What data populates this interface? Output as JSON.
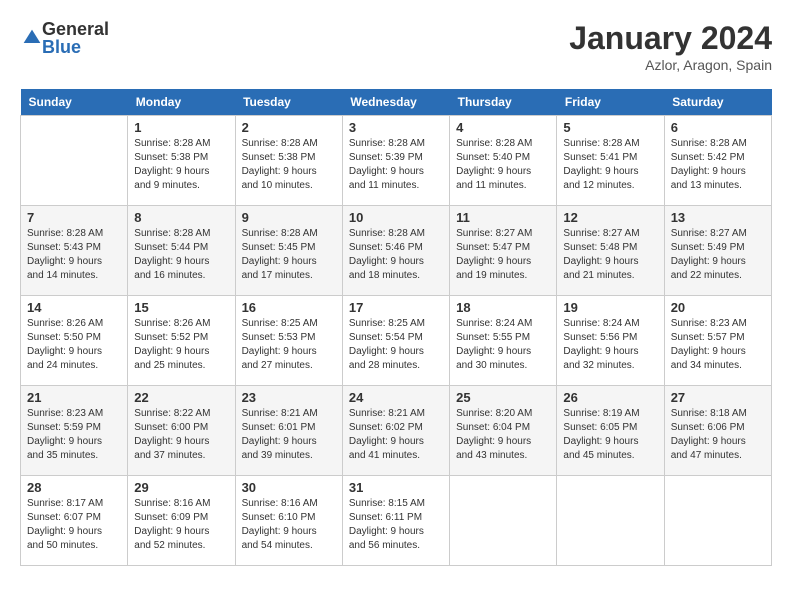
{
  "header": {
    "logo_general": "General",
    "logo_blue": "Blue",
    "month_title": "January 2024",
    "location": "Azlor, Aragon, Spain"
  },
  "columns": [
    "Sunday",
    "Monday",
    "Tuesday",
    "Wednesday",
    "Thursday",
    "Friday",
    "Saturday"
  ],
  "weeks": [
    [
      {
        "day": "",
        "info": ""
      },
      {
        "day": "1",
        "info": "Sunrise: 8:28 AM\nSunset: 5:38 PM\nDaylight: 9 hours\nand 9 minutes."
      },
      {
        "day": "2",
        "info": "Sunrise: 8:28 AM\nSunset: 5:38 PM\nDaylight: 9 hours\nand 10 minutes."
      },
      {
        "day": "3",
        "info": "Sunrise: 8:28 AM\nSunset: 5:39 PM\nDaylight: 9 hours\nand 11 minutes."
      },
      {
        "day": "4",
        "info": "Sunrise: 8:28 AM\nSunset: 5:40 PM\nDaylight: 9 hours\nand 11 minutes."
      },
      {
        "day": "5",
        "info": "Sunrise: 8:28 AM\nSunset: 5:41 PM\nDaylight: 9 hours\nand 12 minutes."
      },
      {
        "day": "6",
        "info": "Sunrise: 8:28 AM\nSunset: 5:42 PM\nDaylight: 9 hours\nand 13 minutes."
      }
    ],
    [
      {
        "day": "7",
        "info": "Sunrise: 8:28 AM\nSunset: 5:43 PM\nDaylight: 9 hours\nand 14 minutes."
      },
      {
        "day": "8",
        "info": "Sunrise: 8:28 AM\nSunset: 5:44 PM\nDaylight: 9 hours\nand 16 minutes."
      },
      {
        "day": "9",
        "info": "Sunrise: 8:28 AM\nSunset: 5:45 PM\nDaylight: 9 hours\nand 17 minutes."
      },
      {
        "day": "10",
        "info": "Sunrise: 8:28 AM\nSunset: 5:46 PM\nDaylight: 9 hours\nand 18 minutes."
      },
      {
        "day": "11",
        "info": "Sunrise: 8:27 AM\nSunset: 5:47 PM\nDaylight: 9 hours\nand 19 minutes."
      },
      {
        "day": "12",
        "info": "Sunrise: 8:27 AM\nSunset: 5:48 PM\nDaylight: 9 hours\nand 21 minutes."
      },
      {
        "day": "13",
        "info": "Sunrise: 8:27 AM\nSunset: 5:49 PM\nDaylight: 9 hours\nand 22 minutes."
      }
    ],
    [
      {
        "day": "14",
        "info": "Sunrise: 8:26 AM\nSunset: 5:50 PM\nDaylight: 9 hours\nand 24 minutes."
      },
      {
        "day": "15",
        "info": "Sunrise: 8:26 AM\nSunset: 5:52 PM\nDaylight: 9 hours\nand 25 minutes."
      },
      {
        "day": "16",
        "info": "Sunrise: 8:25 AM\nSunset: 5:53 PM\nDaylight: 9 hours\nand 27 minutes."
      },
      {
        "day": "17",
        "info": "Sunrise: 8:25 AM\nSunset: 5:54 PM\nDaylight: 9 hours\nand 28 minutes."
      },
      {
        "day": "18",
        "info": "Sunrise: 8:24 AM\nSunset: 5:55 PM\nDaylight: 9 hours\nand 30 minutes."
      },
      {
        "day": "19",
        "info": "Sunrise: 8:24 AM\nSunset: 5:56 PM\nDaylight: 9 hours\nand 32 minutes."
      },
      {
        "day": "20",
        "info": "Sunrise: 8:23 AM\nSunset: 5:57 PM\nDaylight: 9 hours\nand 34 minutes."
      }
    ],
    [
      {
        "day": "21",
        "info": "Sunrise: 8:23 AM\nSunset: 5:59 PM\nDaylight: 9 hours\nand 35 minutes."
      },
      {
        "day": "22",
        "info": "Sunrise: 8:22 AM\nSunset: 6:00 PM\nDaylight: 9 hours\nand 37 minutes."
      },
      {
        "day": "23",
        "info": "Sunrise: 8:21 AM\nSunset: 6:01 PM\nDaylight: 9 hours\nand 39 minutes."
      },
      {
        "day": "24",
        "info": "Sunrise: 8:21 AM\nSunset: 6:02 PM\nDaylight: 9 hours\nand 41 minutes."
      },
      {
        "day": "25",
        "info": "Sunrise: 8:20 AM\nSunset: 6:04 PM\nDaylight: 9 hours\nand 43 minutes."
      },
      {
        "day": "26",
        "info": "Sunrise: 8:19 AM\nSunset: 6:05 PM\nDaylight: 9 hours\nand 45 minutes."
      },
      {
        "day": "27",
        "info": "Sunrise: 8:18 AM\nSunset: 6:06 PM\nDaylight: 9 hours\nand 47 minutes."
      }
    ],
    [
      {
        "day": "28",
        "info": "Sunrise: 8:17 AM\nSunset: 6:07 PM\nDaylight: 9 hours\nand 50 minutes."
      },
      {
        "day": "29",
        "info": "Sunrise: 8:16 AM\nSunset: 6:09 PM\nDaylight: 9 hours\nand 52 minutes."
      },
      {
        "day": "30",
        "info": "Sunrise: 8:16 AM\nSunset: 6:10 PM\nDaylight: 9 hours\nand 54 minutes."
      },
      {
        "day": "31",
        "info": "Sunrise: 8:15 AM\nSunset: 6:11 PM\nDaylight: 9 hours\nand 56 minutes."
      },
      {
        "day": "",
        "info": ""
      },
      {
        "day": "",
        "info": ""
      },
      {
        "day": "",
        "info": ""
      }
    ]
  ]
}
